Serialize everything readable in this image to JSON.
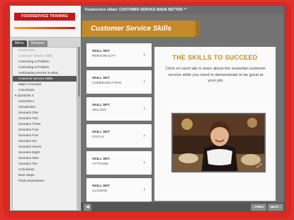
{
  "header": {
    "title": "Foodservice eStart: CUSTOMER SERVICE MADE BETTER.™"
  },
  "logo": {
    "text": "FOODSERVICE TRAINING PORTAL"
  },
  "sidebar": {
    "tabs": [
      "Menu",
      "Glossary"
    ],
    "items": [
      {
        "label": "Introduction",
        "state": "dim"
      },
      {
        "label": "Customer Service Skills",
        "state": "dim"
      },
      {
        "label": "Correcting a Problem",
        "state": "normal"
      },
      {
        "label": "Correcting a Problem",
        "state": "normal"
      },
      {
        "label": "Anticipating service is what...",
        "state": "normal"
      },
      {
        "label": "Customer Service Skills",
        "state": "selected"
      },
      {
        "label": "Major Concepts",
        "state": "normal"
      },
      {
        "label": "Conclusion",
        "state": "normal"
      },
      {
        "label": "▾ LESSON 4",
        "state": "group"
      },
      {
        "label": "LESSON 4",
        "state": "normal"
      },
      {
        "label": "Introduction",
        "state": "normal"
      },
      {
        "label": "Scenario One",
        "state": "normal"
      },
      {
        "label": "Scenario Two",
        "state": "normal"
      },
      {
        "label": "Scenario Three",
        "state": "normal"
      },
      {
        "label": "Scenario Four",
        "state": "normal"
      },
      {
        "label": "Scenario Five",
        "state": "normal"
      },
      {
        "label": "Scenario Six",
        "state": "normal"
      },
      {
        "label": "Scenario Seven",
        "state": "normal"
      },
      {
        "label": "Scenario Eight",
        "state": "normal"
      },
      {
        "label": "Scenario Nine",
        "state": "normal"
      },
      {
        "label": "Scenario Ten",
        "state": "normal"
      },
      {
        "label": "Conclusion",
        "state": "normal"
      },
      {
        "label": "Next Steps",
        "state": "normal"
      },
      {
        "label": "Final Assessment",
        "state": "normal"
      }
    ]
  },
  "main": {
    "title": "Customer Service Skills",
    "skills": [
      {
        "label": "SKILL SET:",
        "name": "PERSONALITY"
      },
      {
        "label": "SKILL SET:",
        "name": "COMMUNICATION"
      },
      {
        "label": "SKILL SET:",
        "name": "SELLING"
      },
      {
        "label": "SKILL SET:",
        "name": "FOCUS"
      },
      {
        "label": "SKILL SET:",
        "name": "ATTITUDE"
      },
      {
        "label": "SKILL SET:",
        "name": "CLOSING"
      }
    ],
    "panel": {
      "title": "THE SKILLS TO SUCCEED",
      "body": "Click on each tab to learn about the essential customer service skills you need to demonstrate to be great at your job."
    }
  },
  "footer": {
    "prev": "‹ PREV",
    "next": "NEXT ›",
    "back": "◀"
  },
  "colors": {
    "frame": "#d72a23",
    "accent": "#c48a2a"
  }
}
